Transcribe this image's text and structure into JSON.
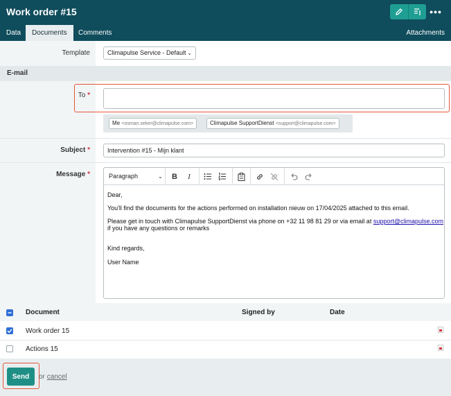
{
  "header": {
    "title": "Work order #15"
  },
  "tabs": [
    {
      "label": "Data"
    },
    {
      "label": "Documents"
    },
    {
      "label": "Comments"
    }
  ],
  "attachments_label": "Attachments",
  "form": {
    "template_label": "Template",
    "template_value": "Climapulse Service - Default",
    "section_email": "E-mail",
    "to_label": "To",
    "required_mark": "*",
    "recipients": [
      {
        "name": "Me",
        "email": "<osman.seker@climapulse.com>"
      },
      {
        "name": "Climapulse SupportDienst",
        "email": "<support@climapulse.com>"
      }
    ],
    "subject_label": "Subject",
    "subject_value": "Intervention #15 - Mijn klant",
    "message_label": "Message",
    "paragraph_style": "Paragraph",
    "message": {
      "line1": "Dear,",
      "line2": "You'll find the documents for the actions performed on installation nieuw on 17/04/2025 attached to this email.",
      "line3a": "Please get in touch with Climapulse SupportDienst via phone on +32 11 98 81 29 or via email at ",
      "line3_link": "support@climapulse.com",
      "line4": "if you have any questions or remarks",
      "line5": "Kind regards,",
      "line6": "User Name"
    }
  },
  "documents": {
    "columns": {
      "document": "Document",
      "signed_by": "Signed by",
      "date": "Date"
    },
    "rows": [
      {
        "name": "Work order 15",
        "checked": true
      },
      {
        "name": "Actions 15",
        "checked": false
      }
    ]
  },
  "footer": {
    "send_label": "Send",
    "or_label": "or",
    "cancel_label": "cancel"
  },
  "colors": {
    "header": "#0f4c5c",
    "accent": "#1f8f86",
    "highlight": "#e5553b",
    "checkbox": "#2f6fd6"
  }
}
